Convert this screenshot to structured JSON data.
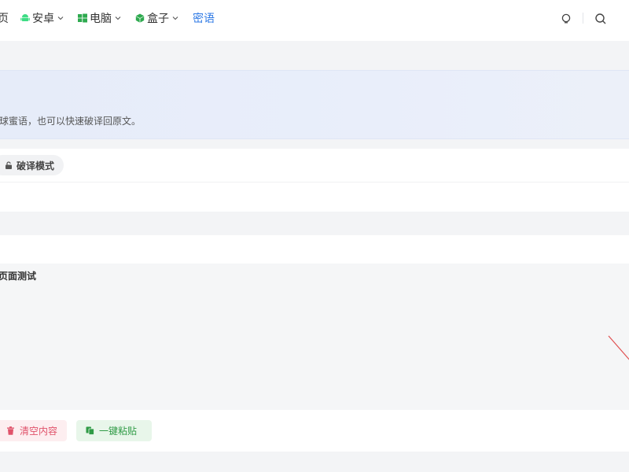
{
  "nav": {
    "home_label": "页",
    "android_label": "安卓",
    "pc_label": "电脑",
    "box_label": "盒子",
    "secret_label": "密语"
  },
  "banner": {
    "description": "球蜜语，也可以快速破译回原文。"
  },
  "mode": {
    "decode_label": "破译模式"
  },
  "editor": {
    "content": "页面测试"
  },
  "actions": {
    "clear_label": "清空内容",
    "paste_label": "一键粘贴"
  },
  "colors": {
    "accent": "#2f7ae5",
    "android_green": "#3ddc84",
    "windows_green": "#2eaa4f",
    "box_green": "#2eaa4f",
    "danger": "#e0526a",
    "success": "#2f9b46"
  }
}
